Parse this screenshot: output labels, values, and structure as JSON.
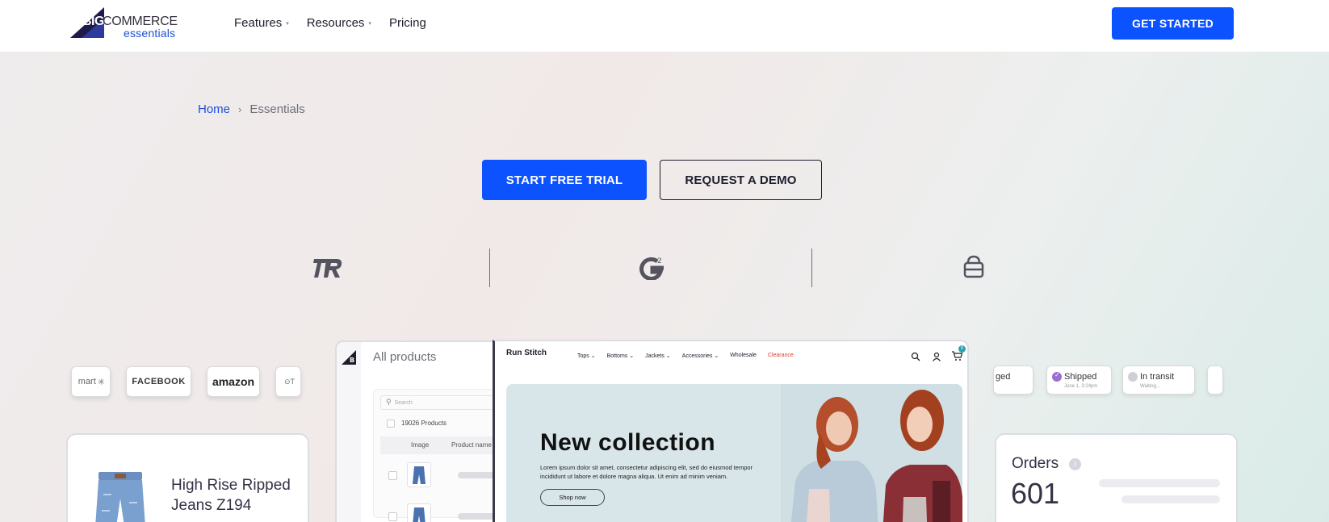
{
  "header": {
    "logo": {
      "big": "BIG",
      "commerce": "COMMERCE",
      "essentials": "essentials"
    },
    "nav": [
      {
        "label": "Features",
        "has_dropdown": true
      },
      {
        "label": "Resources",
        "has_dropdown": true
      },
      {
        "label": "Pricing",
        "has_dropdown": false
      }
    ],
    "cta_label": "GET STARTED"
  },
  "breadcrumb": {
    "home": "Home",
    "separator": "›",
    "current": "Essentials"
  },
  "hero": {
    "primary_cta": "START FREE TRIAL",
    "secondary_cta": "REQUEST A DEMO",
    "rating_logos": [
      "trustradius-icon",
      "g2-icon",
      "capterra-bag-icon"
    ]
  },
  "channels": {
    "items": [
      "mart",
      "FACEBOOK",
      "amazon",
      "T"
    ]
  },
  "product_card": {
    "title": "High Rise Ripped Jeans Z194"
  },
  "admin": {
    "title": "All products",
    "search_placeholder": "Search",
    "count_label": "19026 Products",
    "columns": [
      "Image",
      "Product name"
    ]
  },
  "storefront": {
    "brand": "Run Stitch",
    "nav": [
      "Tops",
      "Bottoms",
      "Jackets",
      "Accessories",
      "Wholesale",
      "Clearance"
    ],
    "cart_count": "0",
    "headline": "New collection",
    "description": "Lorem ipsum dolor sit amet, consectetur adipiscing elit, sed do eiusmod tempor incididunt ut labore et dolore magna aliqua. Ut enim ad minim veniam.",
    "button": "Shop now"
  },
  "shipping": {
    "statuses": [
      {
        "label": "ged",
        "sub": ""
      },
      {
        "label": "Shipped",
        "sub": "June 1, 3:24pm"
      },
      {
        "label": "In transit",
        "sub": "Waiting..."
      }
    ]
  },
  "orders_card": {
    "label": "Orders",
    "value": "601"
  },
  "colors": {
    "brand_blue": "#0d52ff",
    "link_blue": "#1d4ed8",
    "clearance_red": "#e33b2b"
  }
}
